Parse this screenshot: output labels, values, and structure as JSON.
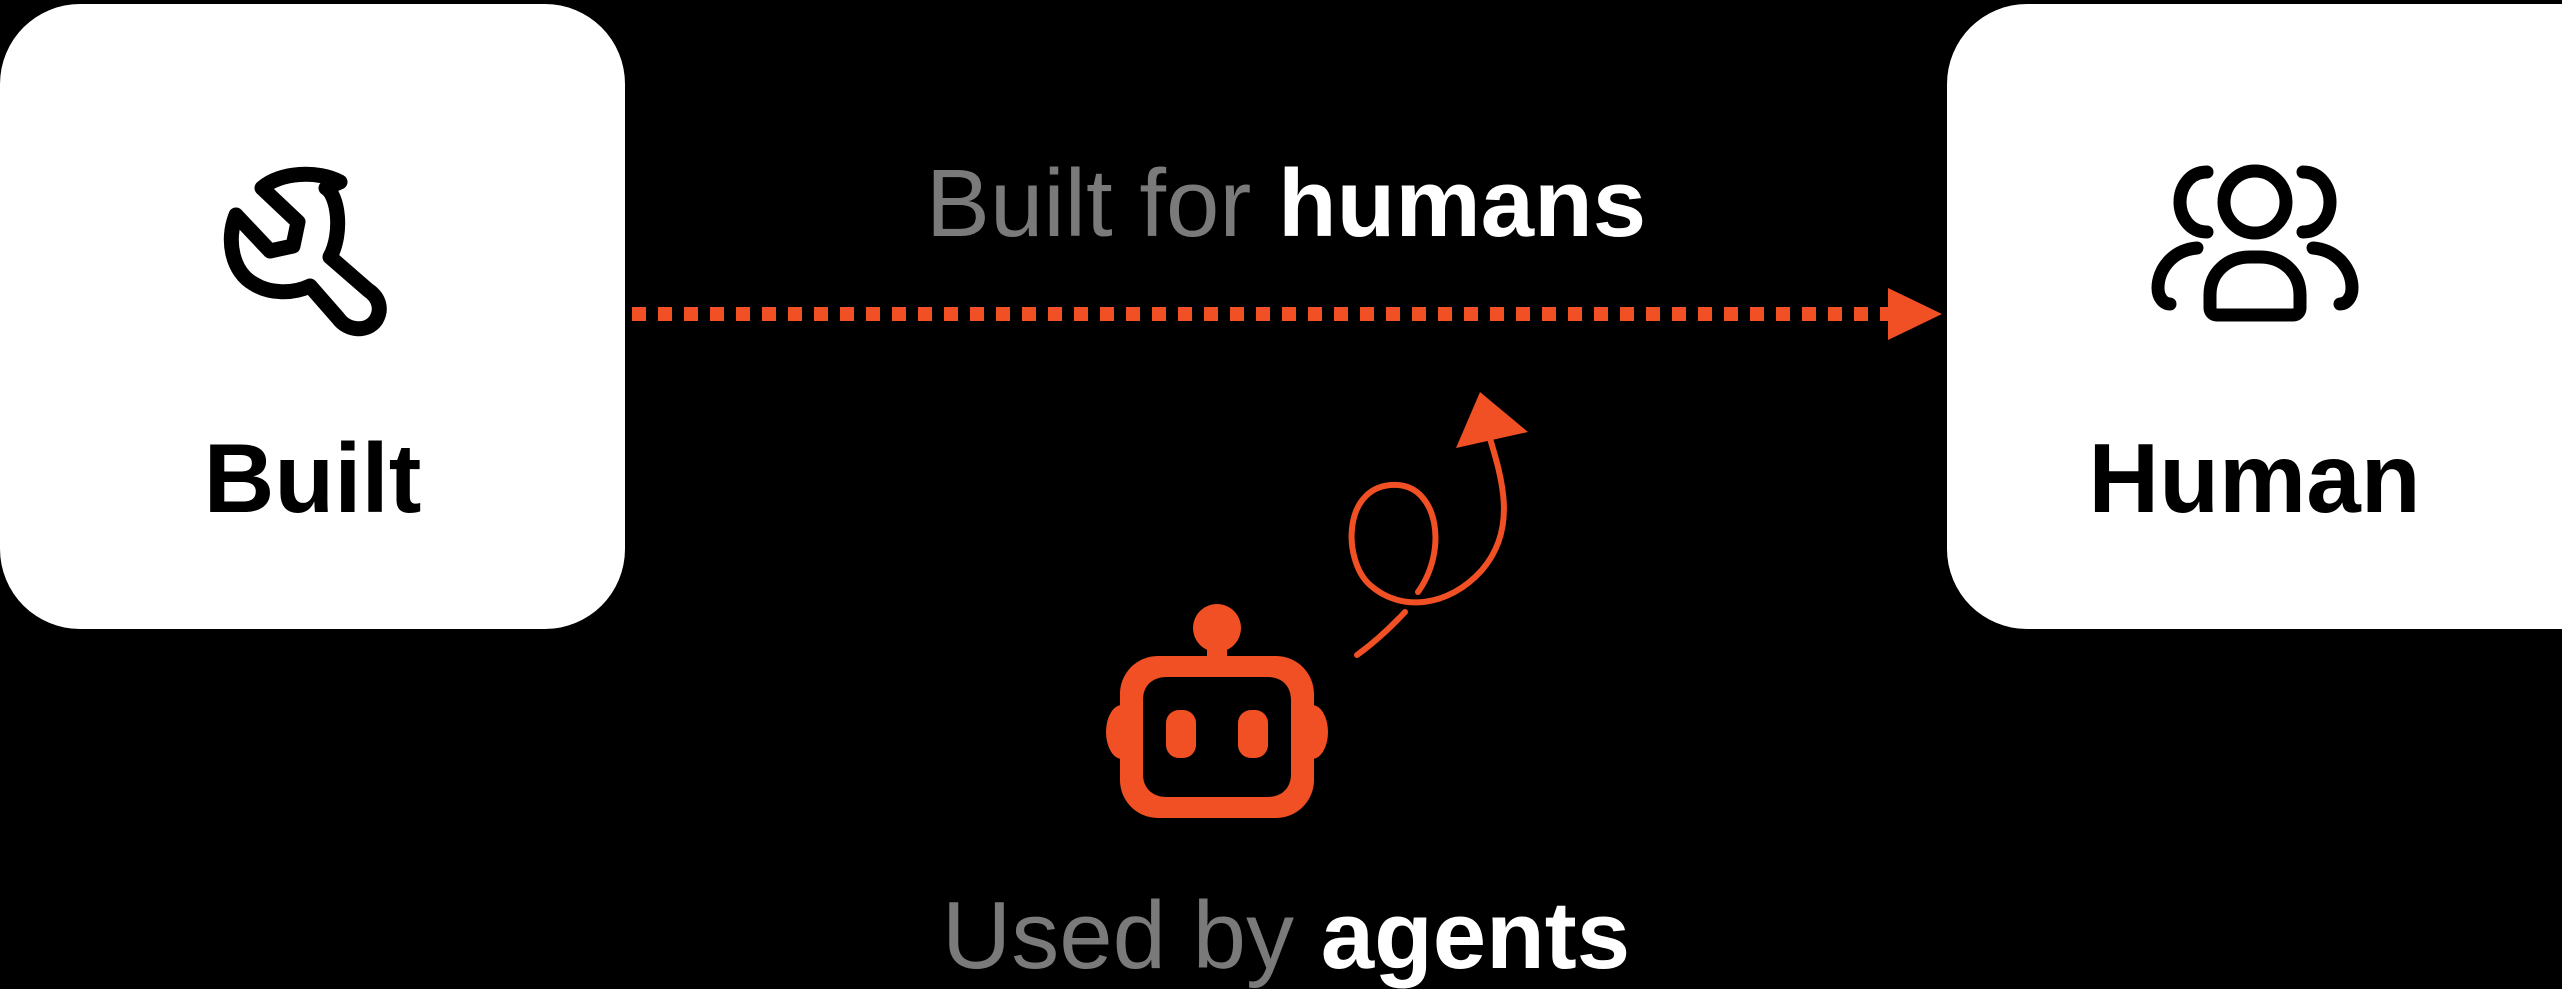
{
  "cards": {
    "left": {
      "label": "Built",
      "icon": "wrench-icon"
    },
    "right": {
      "label": "Human",
      "icon": "users-icon"
    }
  },
  "captions": {
    "top": {
      "prefix": "Built for",
      "emphasis": "humans"
    },
    "bottom": {
      "prefix": "Used by",
      "emphasis": "agents"
    }
  },
  "center_icon": "robot-icon",
  "colors": {
    "background": "#000000",
    "card": "#ffffff",
    "accent": "#f05023",
    "muted_text": "#7a7a7a",
    "strong_text": "#ffffff"
  }
}
